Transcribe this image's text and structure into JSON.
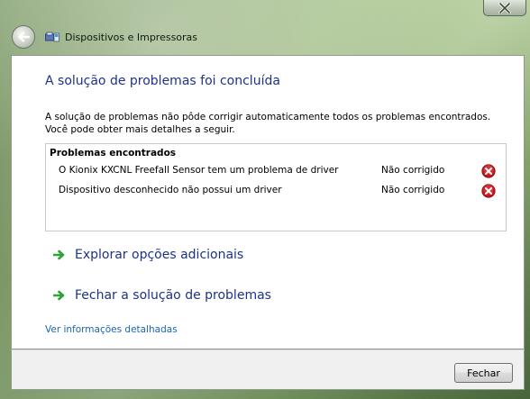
{
  "window": {
    "title": "Dispositivos e Impressoras"
  },
  "content": {
    "heading": "A solução de problemas foi concluída",
    "description_line1": "A solução de problemas não pôde corrigir automaticamente todos os problemas encontrados.",
    "description_line2": "Você pode obter mais detalhes a seguir."
  },
  "problems": {
    "title": "Problemas encontrados",
    "items": [
      {
        "name": "O Kionix KXCNL Freefall Sensor tem um problema de driver",
        "status": "Não corrigido",
        "icon": "error-icon"
      },
      {
        "name": "Dispositivo desconhecido não possui um driver",
        "status": "Não corrigido",
        "icon": "error-icon"
      }
    ]
  },
  "links": {
    "explore": "Explorar opções adicionais",
    "close_troubleshooting": "Fechar a solução de problemas",
    "details": "Ver informações detalhadas"
  },
  "footer": {
    "close_button": "Fechar"
  },
  "colors": {
    "heading": "#1e3287",
    "link": "#1665b8",
    "error": "#c8161d",
    "arrow": "#2fa43a"
  }
}
